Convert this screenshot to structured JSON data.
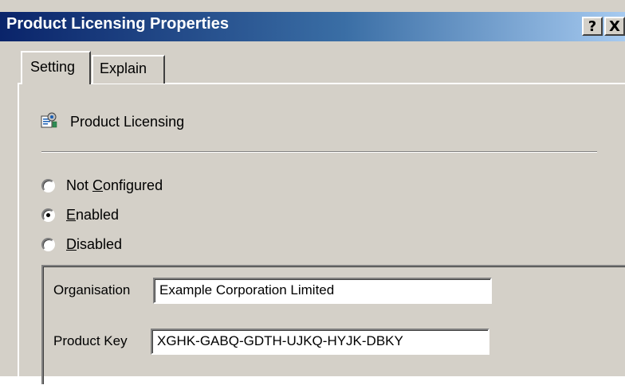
{
  "window": {
    "title": "Product Licensing Properties",
    "help_button": "?",
    "close_button": "X"
  },
  "tabs": [
    {
      "label": "Setting",
      "active": true
    },
    {
      "label": "Explain",
      "active": false
    }
  ],
  "policy": {
    "name": "Product Licensing",
    "icon": "policy-settings-icon"
  },
  "radios": [
    {
      "prefix": "Not ",
      "mnemonic": "C",
      "suffix": "onfigured",
      "checked": false
    },
    {
      "prefix": "",
      "mnemonic": "E",
      "suffix": "nabled",
      "checked": true
    },
    {
      "prefix": "",
      "mnemonic": "D",
      "suffix": "isabled",
      "checked": false
    }
  ],
  "options": {
    "organisation_label": "Organisation",
    "organisation_value": "Example Corporation Limited",
    "product_key_label": "Product Key",
    "product_key_value": "XGHK-GABQ-GDTH-UJKQ-HYJK-DBKY"
  }
}
